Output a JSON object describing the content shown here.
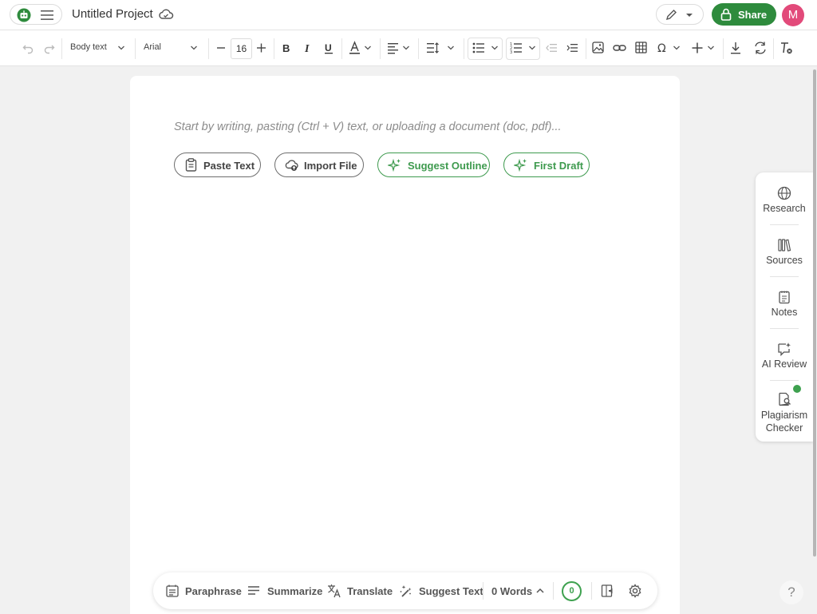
{
  "app": {
    "project_title": "Untitled Project",
    "share_label": "Share",
    "avatar_initial": "M",
    "brand_color": "#2e8b3d",
    "avatar_color": "#e24a7a"
  },
  "toolbar": {
    "style_select": "Body text",
    "font_select": "Arial",
    "font_size": "16"
  },
  "editor": {
    "placeholder": "Start by writing, pasting (Ctrl + V) text, or uploading a document (doc, pdf)...",
    "buttons": {
      "paste_text": "Paste Text",
      "import_file": "Import File",
      "suggest_outline": "Suggest Outline",
      "first_draft": "First Draft"
    }
  },
  "sidepanel": {
    "items": {
      "research": "Research",
      "sources": "Sources",
      "notes": "Notes",
      "ai_review": "AI Review",
      "plagiarism_line1": "Plagiarism",
      "plagiarism_line2": "Checker"
    }
  },
  "bottombar": {
    "paraphrase": "Paraphrase",
    "summarize": "Summarize",
    "translate": "Translate",
    "suggest_text": "Suggest Text",
    "word_count": "0 Words",
    "issues_count": "0"
  },
  "help_label": "?"
}
